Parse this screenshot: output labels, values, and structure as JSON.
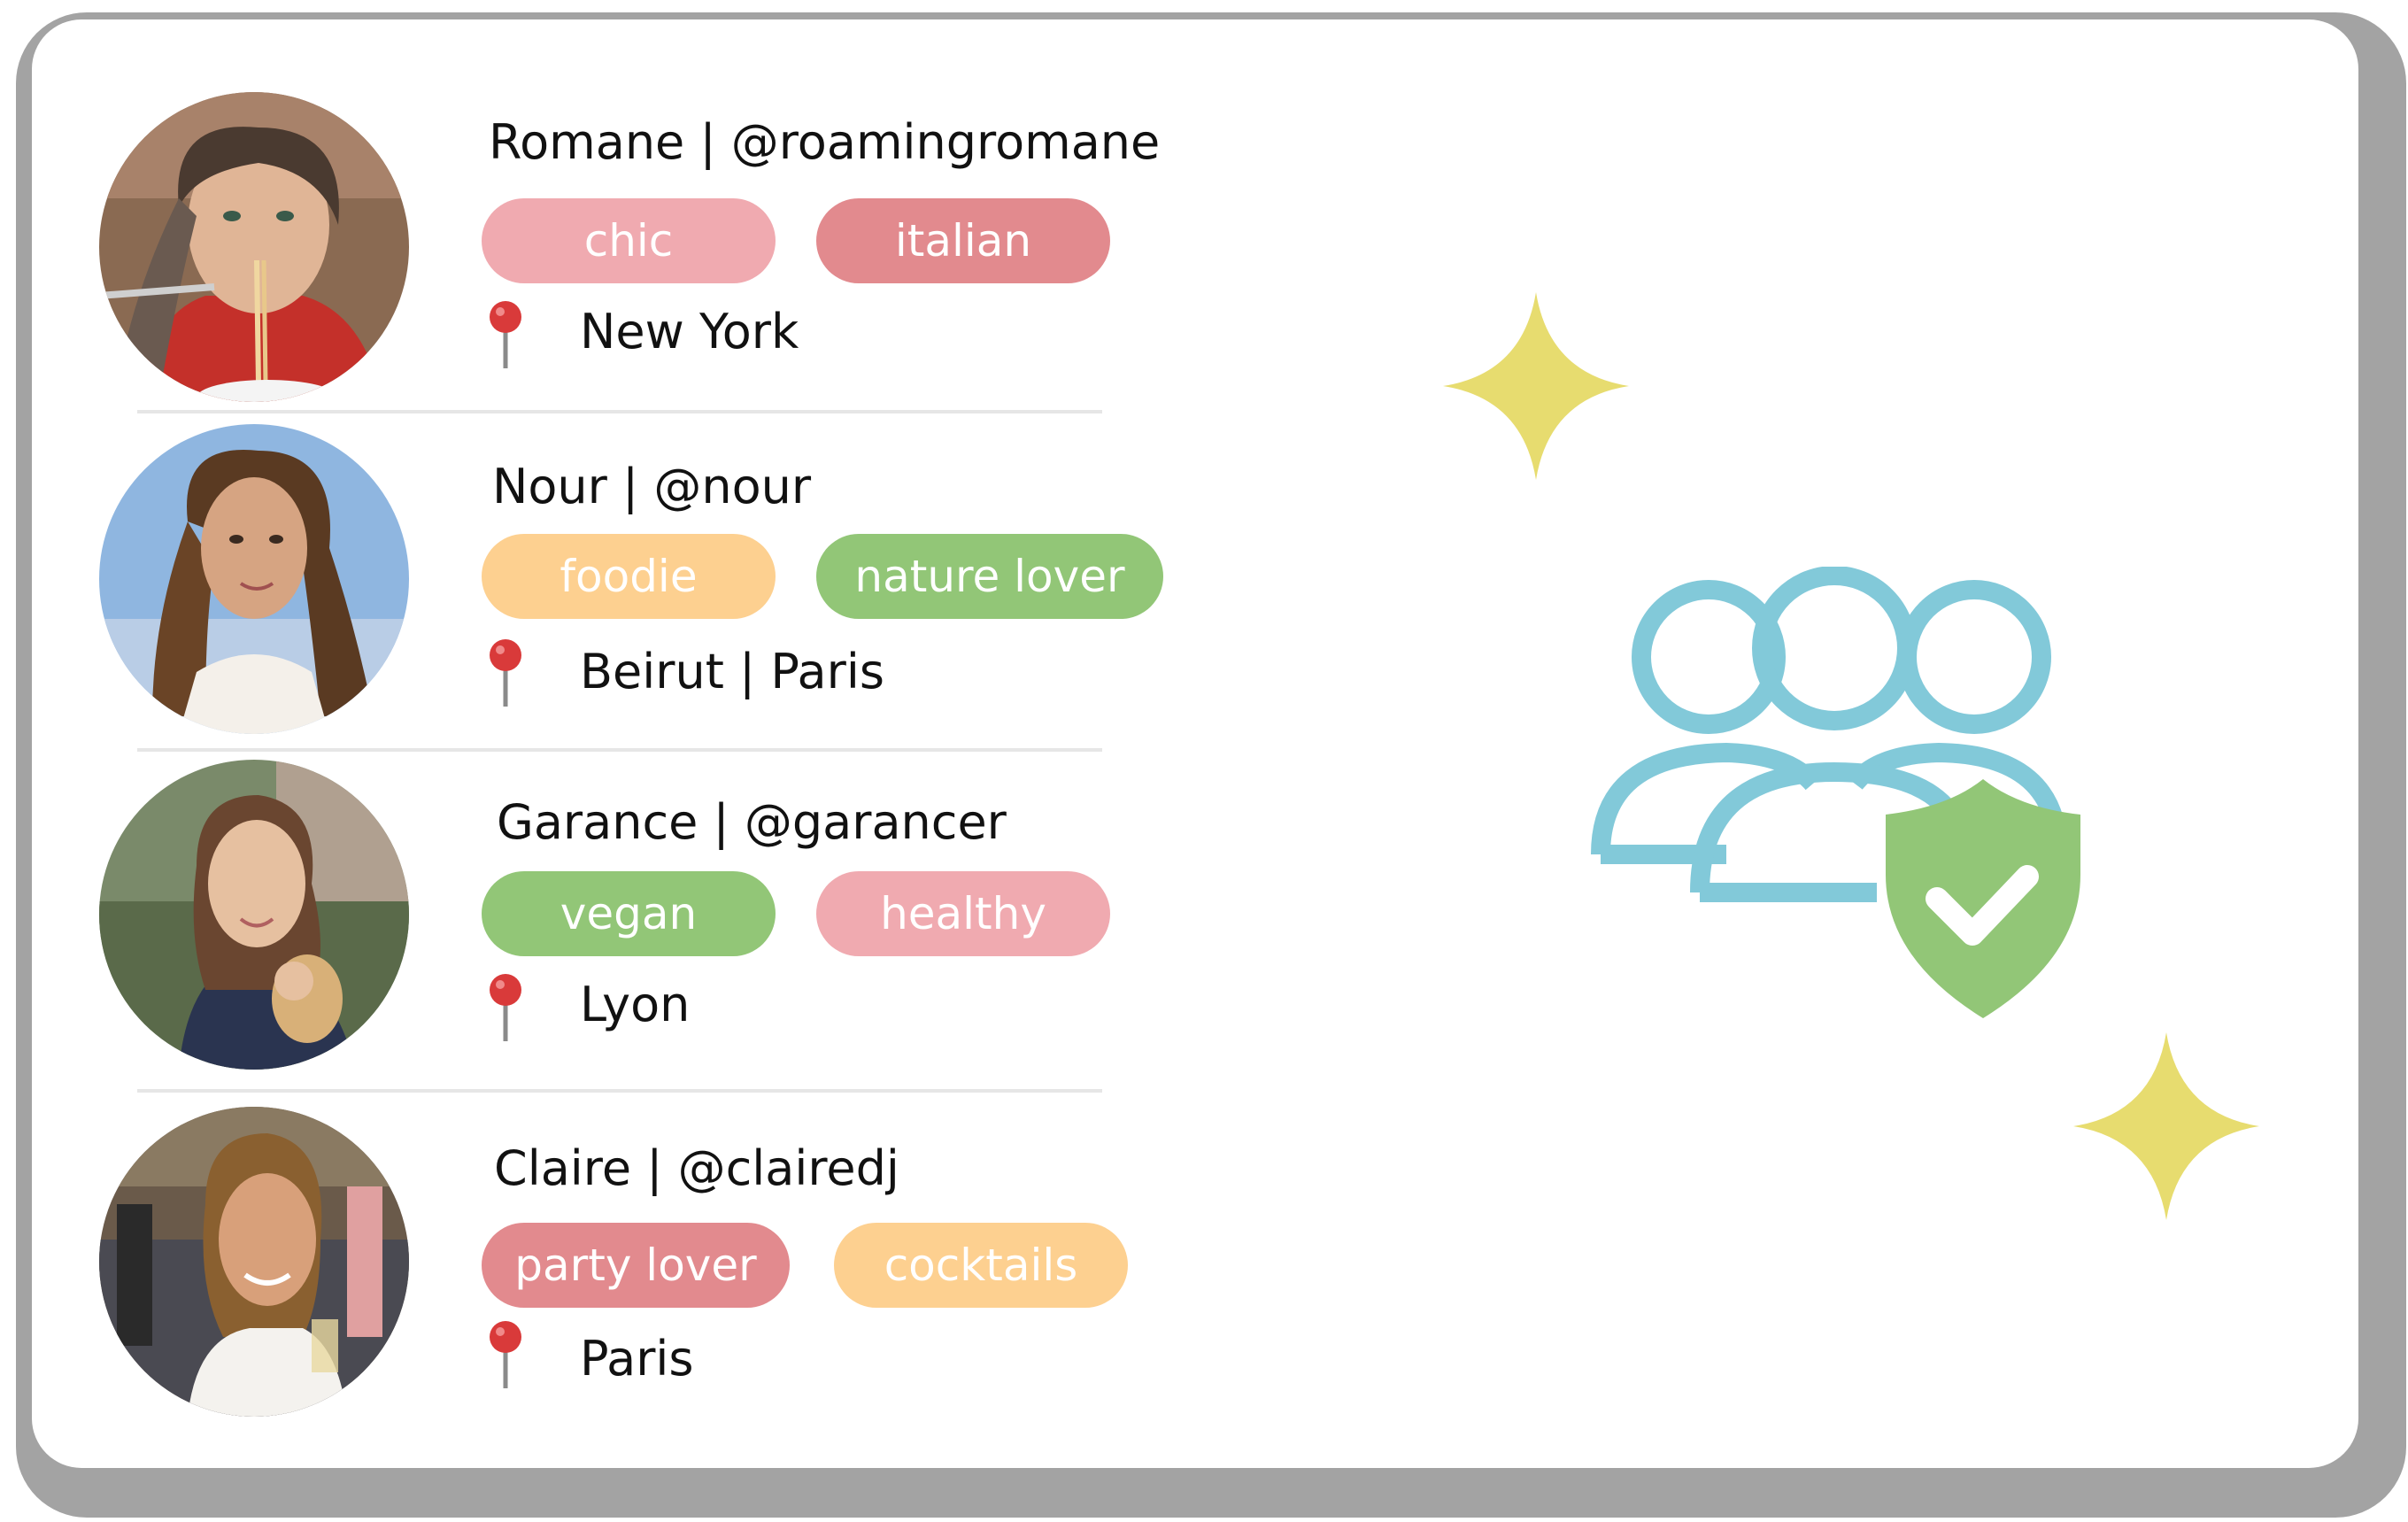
{
  "colors": {
    "pink": "#f0aab0",
    "red": "#e28a8e",
    "orange": "#fdd090",
    "green": "#92c677",
    "blue": "#82c9d9",
    "yellow": "#e7dc6f",
    "frame": "#a3a3a3"
  },
  "profiles": [
    {
      "name": "Romane | @roamingromane",
      "tags": [
        {
          "label": "chic",
          "color": "pink"
        },
        {
          "label": "italian",
          "color": "red"
        }
      ],
      "location": "New York",
      "pin_icon": "pin-icon"
    },
    {
      "name": "Nour | @nour",
      "tags": [
        {
          "label": "foodie",
          "color": "orange"
        },
        {
          "label": "nature lover",
          "color": "green"
        }
      ],
      "location": "Beirut | Paris",
      "pin_icon": "pin-icon"
    },
    {
      "name": "Garance | @garancer",
      "tags": [
        {
          "label": "vegan",
          "color": "green"
        },
        {
          "label": "healthy",
          "color": "pink"
        }
      ],
      "location": "Lyon",
      "pin_icon": "pin-icon"
    },
    {
      "name": "Claire | @clairedj",
      "tags": [
        {
          "label": "party lover",
          "color": "red"
        },
        {
          "label": "cocktails",
          "color": "orange"
        }
      ],
      "location": "Paris",
      "pin_icon": "pin-icon"
    }
  ],
  "illustration": {
    "group_icon": "users-group-icon",
    "shield_icon": "shield-check-icon",
    "sparkle_icon": "sparkle-icon"
  }
}
